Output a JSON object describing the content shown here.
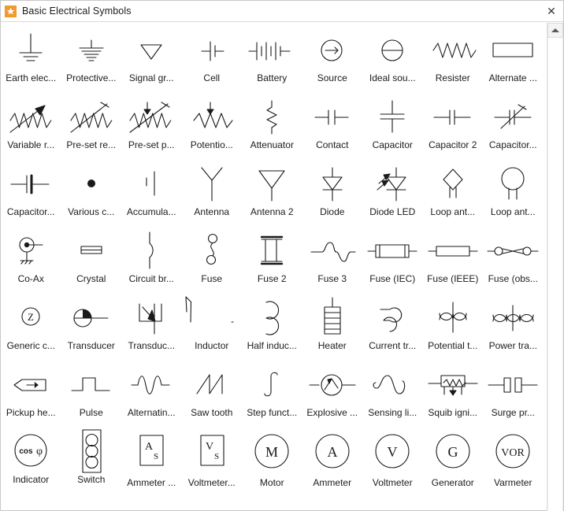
{
  "window": {
    "title": "Basic Electrical Symbols",
    "app_icon": "star-icon",
    "close_label": "✕",
    "accent_color": "#f29a2e",
    "stroke_color": "#1a1a1a",
    "background_color": "#ffffff"
  },
  "scrollbar": {
    "up_arrow": "scroll-up-arrow",
    "position": "top"
  },
  "library": {
    "columns": 8,
    "symbols": [
      {
        "label": "Earth elec...",
        "glyph": "earth-electrode"
      },
      {
        "label": "Protective...",
        "glyph": "protective-earth"
      },
      {
        "label": "Signal gr...",
        "glyph": "signal-ground"
      },
      {
        "label": "Cell",
        "glyph": "cell"
      },
      {
        "label": "Battery",
        "glyph": "battery"
      },
      {
        "label": "Source",
        "glyph": "source"
      },
      {
        "label": "Ideal sou...",
        "glyph": "ideal-source"
      },
      {
        "label": "Resister",
        "glyph": "resistor-zigzag"
      },
      {
        "label": "Alternate ...",
        "glyph": "resistor-box"
      },
      {
        "label": "Variable r...",
        "glyph": "variable-resistor"
      },
      {
        "label": "Pre-set re...",
        "glyph": "preset-resistor"
      },
      {
        "label": "Pre-set p...",
        "glyph": "preset-potentiometer"
      },
      {
        "label": "Potentio...",
        "glyph": "potentiometer"
      },
      {
        "label": "Attenuator",
        "glyph": "attenuator"
      },
      {
        "label": "Contact",
        "glyph": "contact"
      },
      {
        "label": "Capacitor",
        "glyph": "capacitor-vertical"
      },
      {
        "label": "Capacitor 2",
        "glyph": "capacitor-2"
      },
      {
        "label": "Capacitor...",
        "glyph": "capacitor-variable"
      },
      {
        "label": "Capacitor...",
        "glyph": "capacitor-polarized"
      },
      {
        "label": "Various c...",
        "glyph": "various-connection-dot"
      },
      {
        "label": "Accumula...",
        "glyph": "accumulator"
      },
      {
        "label": "Antenna",
        "glyph": "antenna"
      },
      {
        "label": "Antenna 2",
        "glyph": "antenna-2"
      },
      {
        "label": "Diode",
        "glyph": "diode"
      },
      {
        "label": "Diode LED",
        "glyph": "diode-led"
      },
      {
        "label": "Loop ant...",
        "glyph": "loop-antenna-diamond"
      },
      {
        "label": "Loop ant...",
        "glyph": "loop-antenna-circle"
      },
      {
        "label": "Co-Ax",
        "glyph": "co-ax"
      },
      {
        "label": "Crystal",
        "glyph": "crystal"
      },
      {
        "label": "Circuit br...",
        "glyph": "circuit-breaker"
      },
      {
        "label": "Fuse",
        "glyph": "fuse"
      },
      {
        "label": "Fuse 2",
        "glyph": "fuse-2"
      },
      {
        "label": "Fuse 3",
        "glyph": "fuse-3"
      },
      {
        "label": "Fuse (IEC)",
        "glyph": "fuse-iec"
      },
      {
        "label": "Fuse (IEEE)",
        "glyph": "fuse-ieee"
      },
      {
        "label": "Fuse (obs...",
        "glyph": "fuse-obsolete"
      },
      {
        "label": "Generic c...",
        "glyph": "generic-component-z"
      },
      {
        "label": "Transducer",
        "glyph": "transducer"
      },
      {
        "label": "Transduc...",
        "glyph": "transducer-2"
      },
      {
        "label": "Inductor",
        "glyph": "inductor"
      },
      {
        "label": "Half induc...",
        "glyph": "half-inductor"
      },
      {
        "label": "Heater",
        "glyph": "heater"
      },
      {
        "label": "Current tr...",
        "glyph": "current-transformer"
      },
      {
        "label": "Potential t...",
        "glyph": "potential-transformer"
      },
      {
        "label": "Power tra...",
        "glyph": "power-transformer"
      },
      {
        "label": "Pickup he...",
        "glyph": "pickup-head"
      },
      {
        "label": "Pulse",
        "glyph": "pulse"
      },
      {
        "label": "Alternatin...",
        "glyph": "alternating"
      },
      {
        "label": "Saw tooth",
        "glyph": "saw-tooth"
      },
      {
        "label": "Step funct...",
        "glyph": "step-function"
      },
      {
        "label": "Explosive ...",
        "glyph": "explosive"
      },
      {
        "label": "Sensing li...",
        "glyph": "sensing-link"
      },
      {
        "label": "Squib igni...",
        "glyph": "squib-ignitor"
      },
      {
        "label": "Surge pr...",
        "glyph": "surge-protector"
      },
      {
        "label": "Indicator",
        "glyph": "indicator-cos-phi",
        "text": "cos"
      },
      {
        "label": "Switch",
        "glyph": "switch"
      },
      {
        "label": "Ammeter ...",
        "glyph": "ammeter-box",
        "text": "A"
      },
      {
        "label": "Voltmeter...",
        "glyph": "voltmeter-box",
        "text": "V"
      },
      {
        "label": "Motor",
        "glyph": "motor",
        "text": "M"
      },
      {
        "label": "Ammeter",
        "glyph": "ammeter",
        "text": "A"
      },
      {
        "label": "Voltmeter",
        "glyph": "voltmeter",
        "text": "V"
      },
      {
        "label": "Generator",
        "glyph": "generator",
        "text": "G"
      },
      {
        "label": "Varmeter",
        "glyph": "varmeter",
        "text": "VOR"
      }
    ]
  }
}
